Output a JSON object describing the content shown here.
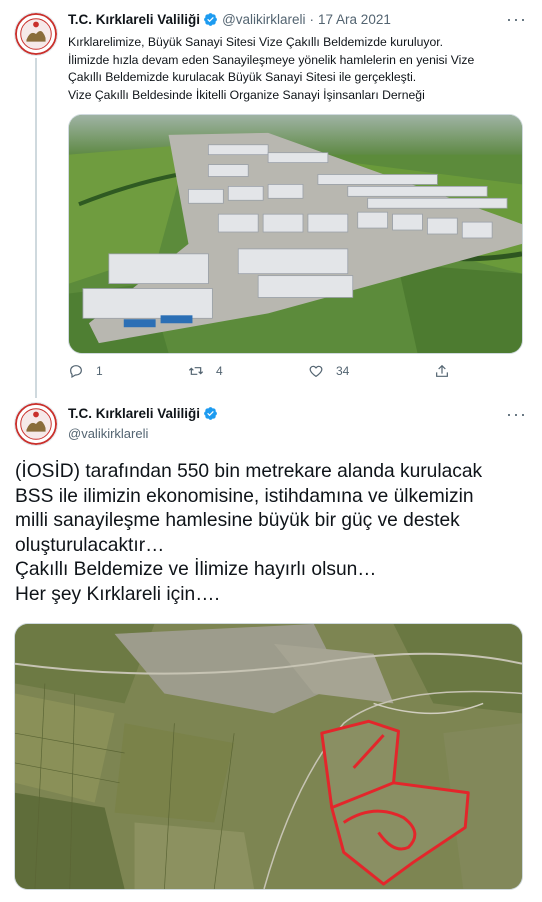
{
  "colors": {
    "accent": "#1d9bf0",
    "secondary_text": "#536471",
    "text": "#0f1419",
    "boundary": "#e3262b"
  },
  "tweet1": {
    "display_name": "T.C. Kırklareli Valiliği",
    "handle": "@valikirklareli",
    "separator": "·",
    "date": "17 Ara 2021",
    "text_lines": [
      "Kırklarelimize, Büyük Sanayi Sitesi Vize Çakıllı Beldemizde kuruluyor.",
      "İlimizde hızla devam eden Sanayileşmeye yönelik hamlelerin en yenisi Vize",
      "Çakıllı Beldemizde kurulacak Büyük Sanayi Sitesi ile gerçekleşti.",
      "Vize Çakıllı Beldesinde İkitelli Organize Sanayi İşinsanları Derneği"
    ],
    "media_alt": "industrial-park-rendering",
    "counts": {
      "reply": "1",
      "retweet": "4",
      "like": "34"
    }
  },
  "tweet2": {
    "display_name": "T.C. Kırklareli Valiliği",
    "handle": "@valikirklareli",
    "text_lines": [
      "(İOSİD) tarafından 550 bin metrekare alanda kurulacak",
      "BSS ile ilimizin ekonomisine, istihdamına ve  ülkemizin",
      "milli sanayileşme hamlesine büyük bir güç ve destek",
      "oluşturulacaktır…",
      "Çakıllı Beldemize ve İlimize hayırlı olsun…",
      "Her şey Kırklareli için…."
    ],
    "media_alt": "satellite-map-with-site-boundary"
  },
  "icons": {
    "verified": "verified-badge-icon",
    "more": "more-icon",
    "reply": "reply-icon",
    "retweet": "retweet-icon",
    "like": "like-icon",
    "share": "share-icon"
  }
}
